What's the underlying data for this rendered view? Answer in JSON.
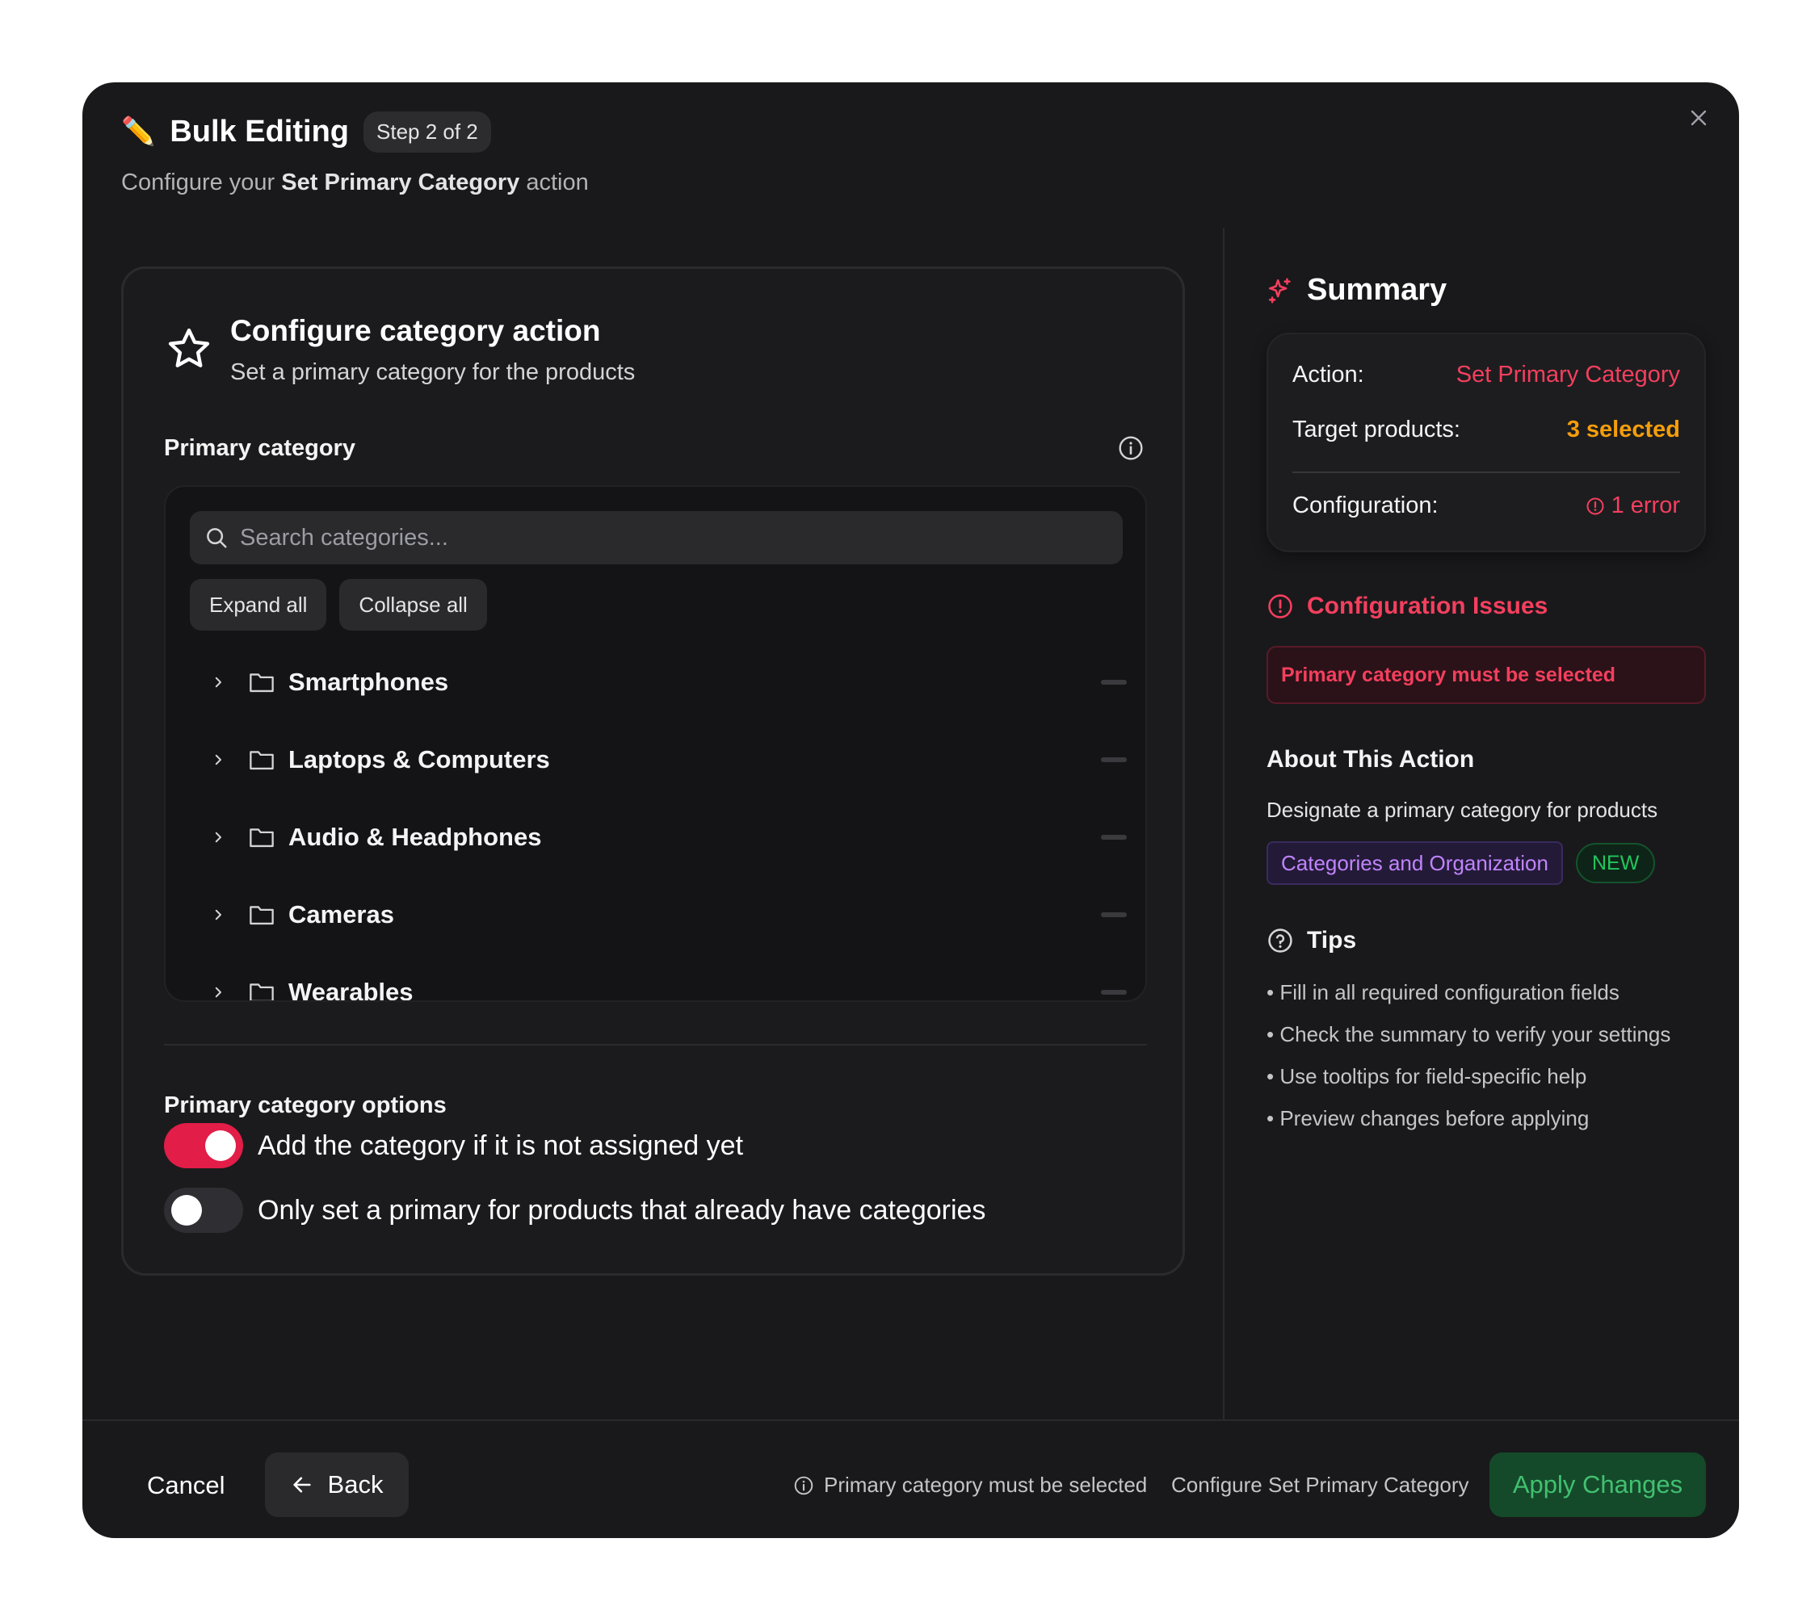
{
  "header": {
    "title": "Bulk Editing",
    "step": "Step 2 of 2",
    "subtitle_prefix": "Configure your",
    "subtitle_action": "Set Primary Category",
    "subtitle_suffix": "action"
  },
  "card": {
    "title": "Configure category action",
    "subtitle": "Set a primary category for the products",
    "field_label": "Primary category",
    "search_placeholder": "Search categories...",
    "expand_all": "Expand all",
    "collapse_all": "Collapse all",
    "categories": [
      "Smartphones",
      "Laptops & Computers",
      "Audio & Headphones",
      "Cameras",
      "Wearables"
    ],
    "options_label": "Primary category options",
    "options": [
      {
        "label": "Add the category if it is not assigned yet",
        "enabled": true
      },
      {
        "label": "Only set a primary for products that already have categories",
        "enabled": false
      }
    ]
  },
  "summary": {
    "title": "Summary",
    "action_key": "Action:",
    "action_value": "Set Primary Category",
    "target_key": "Target products:",
    "target_value": "3 selected",
    "config_key": "Configuration:",
    "config_value": "1 error"
  },
  "issues": {
    "title": "Configuration Issues",
    "items": [
      "Primary category must be selected"
    ]
  },
  "about": {
    "title": "About This Action",
    "description": "Designate a primary category for products",
    "tag": "Categories and Organization",
    "badge": "NEW"
  },
  "tips": {
    "title": "Tips",
    "items": [
      "• Fill in all required configuration fields",
      "• Check the summary to verify your settings",
      "• Use tooltips for field-specific help",
      "• Preview changes before applying"
    ]
  },
  "footer": {
    "cancel": "Cancel",
    "back": "Back",
    "warning": "Primary category must be selected",
    "config_hint": "Configure Set Primary Category",
    "apply": "Apply Changes"
  },
  "colors": {
    "accent_red": "#f43f5e",
    "accent_orange": "#f59e0b",
    "toggle_on": "#e11d48",
    "apply_bg": "#14532d",
    "apply_text": "#4ade80"
  }
}
